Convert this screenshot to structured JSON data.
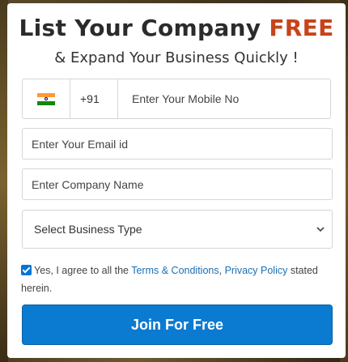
{
  "heading": {
    "prefix": "List Your Company ",
    "highlight": "FREE",
    "highlight_color": "#c8431a",
    "subtitle": "& Expand Your Business Quickly !"
  },
  "phone": {
    "country_flag": "india-flag-icon",
    "country_code": "+91",
    "placeholder": "Enter Your Mobile No",
    "value": ""
  },
  "email": {
    "placeholder": "Enter Your Email id",
    "value": ""
  },
  "company": {
    "placeholder": "Enter Company Name",
    "value": ""
  },
  "business_type": {
    "selected": "Select Business Type",
    "icon": "chevron-down-icon"
  },
  "agreement": {
    "checked": true,
    "text_before": "Yes, I agree to all the ",
    "terms_link": "Terms & Conditions",
    "separator": ", ",
    "privacy_link": "Privacy Policy",
    "text_after": " stated herein."
  },
  "submit": {
    "label": "Join For Free",
    "color": "#0b7ad1"
  }
}
